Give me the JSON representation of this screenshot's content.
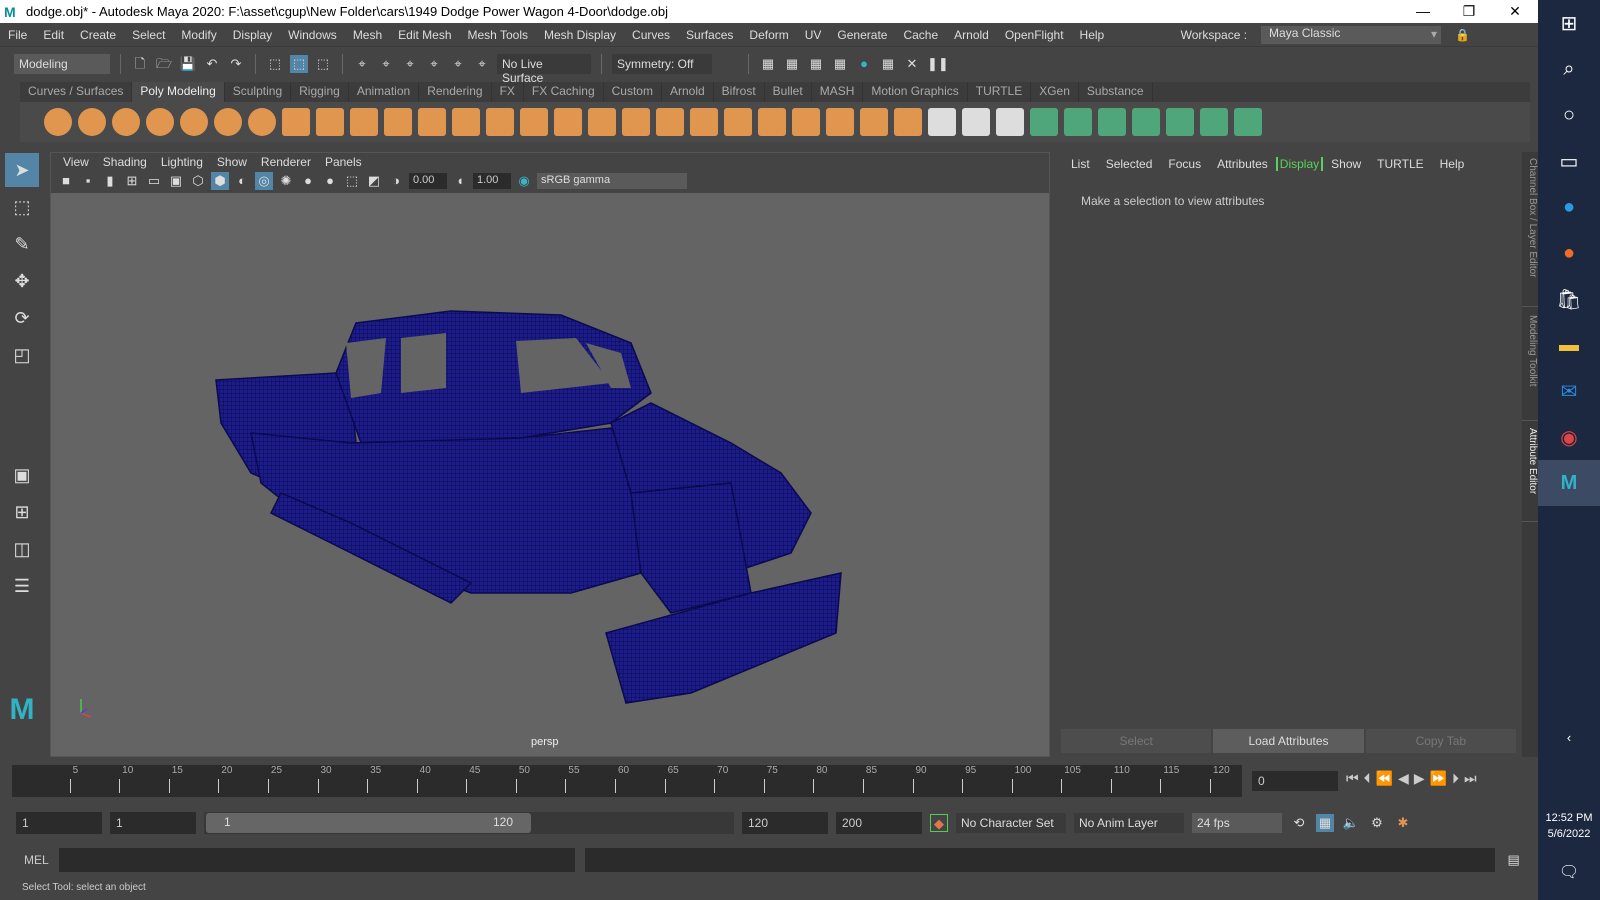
{
  "title": "dodge.obj* - Autodesk Maya 2020: F:\\asset\\cgup\\New Folder\\cars\\1949 Dodge Power Wagon 4-Door\\dodge.obj",
  "window_controls": {
    "minimize": "—",
    "restore": "❐",
    "close": "✕"
  },
  "menu": [
    "File",
    "Edit",
    "Create",
    "Select",
    "Modify",
    "Display",
    "Windows",
    "Mesh",
    "Edit Mesh",
    "Mesh Tools",
    "Mesh Display",
    "Curves",
    "Surfaces",
    "Deform",
    "UV",
    "Generate",
    "Cache",
    "Arnold",
    "OpenFlight",
    "Help"
  ],
  "workspace": {
    "label": "Workspace :",
    "value": "Maya Classic"
  },
  "statusline": {
    "menuset": "Modeling",
    "live_surface": "No Live Surface",
    "symmetry": "Symmetry: Off"
  },
  "shelf_tabs": [
    "Curves / Surfaces",
    "Poly Modeling",
    "Sculpting",
    "Rigging",
    "Animation",
    "Rendering",
    "FX",
    "FX Caching",
    "Custom",
    "Arnold",
    "Bifrost",
    "Bullet",
    "MASH",
    "Motion Graphics",
    "TURTLE",
    "XGen",
    "Substance"
  ],
  "shelf_active": "Poly Modeling",
  "shelf_icons": [
    "sphere",
    "cube",
    "cylinder",
    "cone",
    "torus",
    "plane",
    "disc",
    "platonic",
    "super-shape",
    "type",
    "svg",
    "measure",
    "center-pivot",
    "freeze-transforms",
    "combine",
    "separate",
    "mirror",
    "smooth",
    "extrude",
    "bevel",
    "bridge",
    "fill-hole",
    "add-divisions",
    "multi-cut",
    "target-weld",
    "connect",
    "insert-edge-loop",
    "uv-editor",
    "automatic-uv",
    "planar-uv",
    "cylindrical-uv",
    "spherical-uv",
    "uv-unfold",
    "layout-uv",
    "checker",
    "uv-sew"
  ],
  "shelf_colors": {
    "orange": "#e0964e",
    "green": "#4ea67a",
    "white": "#dddddd"
  },
  "panel_menu": [
    "View",
    "Shading",
    "Lighting",
    "Show",
    "Renderer",
    "Panels"
  ],
  "panel_tools": {
    "exposure": "0.00",
    "gamma": "1.00",
    "colorspace": "sRGB gamma"
  },
  "viewport": {
    "camera": "persp",
    "wire_color": "#12127a",
    "bg": "#646464"
  },
  "attribute_editor": {
    "menu": [
      "List",
      "Selected",
      "Focus",
      "Attributes",
      "Display",
      "Show",
      "TURTLE",
      "Help"
    ],
    "highlighted": "Display",
    "message": "Make a selection to view attributes",
    "buttons": [
      "Select",
      "Load Attributes",
      "Copy Tab"
    ]
  },
  "side_tabs": [
    "Channel Box / Layer Editor",
    "Modeling Toolkit",
    "Attribute Editor"
  ],
  "timeline": {
    "ticks": [
      5,
      10,
      15,
      20,
      25,
      30,
      35,
      40,
      45,
      50,
      55,
      60,
      65,
      70,
      75,
      80,
      85,
      90,
      95,
      100,
      105,
      110,
      115,
      120
    ],
    "current_frame": "0"
  },
  "range": {
    "start": "1",
    "anim_start": "1",
    "range_start": "1",
    "range_end": "120",
    "end": "120",
    "anim_end": "200",
    "character_set": "No Character Set",
    "anim_layer": "No Anim Layer",
    "fps": "24 fps"
  },
  "mel": {
    "label": "MEL"
  },
  "help_line": "Select Tool: select an object",
  "taskbar": {
    "time": "12:52 PM",
    "date": "5/6/2022"
  }
}
